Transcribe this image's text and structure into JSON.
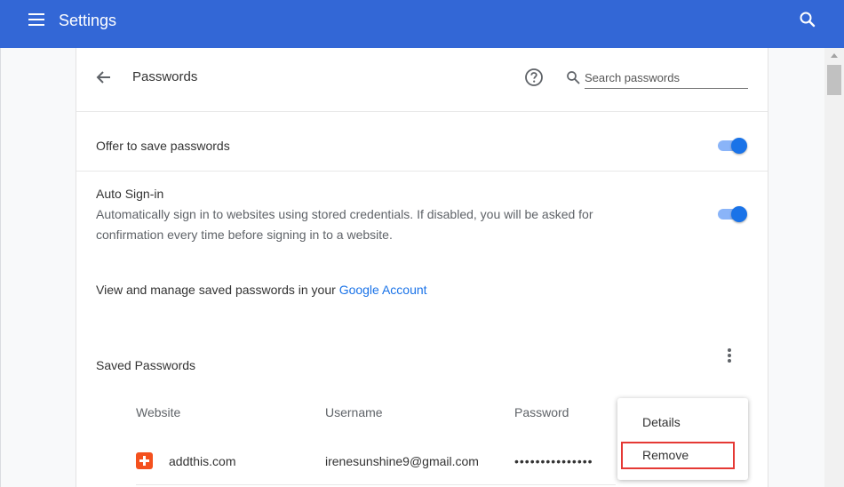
{
  "app": {
    "title": "Settings",
    "menu_icon": "hamburger-menu-icon",
    "search_icon": "search-icon",
    "header_color": "#3367d6"
  },
  "passwords_page": {
    "title": "Passwords",
    "back_icon": "arrow-left-icon",
    "help_icon": "help-circle-icon",
    "search": {
      "placeholder": "Search passwords",
      "value": ""
    }
  },
  "settings": {
    "offer_to_save": {
      "label": "Offer to save passwords",
      "enabled": true
    },
    "auto_signin": {
      "label": "Auto Sign-in",
      "description_line1": "Automatically sign in to websites using stored credentials. If disabled, you will be asked for",
      "description_line2": "confirmation every time before signing in to a website.",
      "enabled": true
    }
  },
  "manage": {
    "text": "View and manage saved passwords in your ",
    "link_text": "Google Account"
  },
  "saved_passwords": {
    "title": "Saved Passwords",
    "more_icon": "more-vert-icon",
    "columns": [
      "Website",
      "Username",
      "Password"
    ],
    "rows": [
      {
        "website": "addthis.com",
        "username": "irenesunshine9@gmail.com",
        "password": "•••••••••••••••"
      }
    ]
  },
  "context_menu": {
    "items": [
      "Details",
      "Remove"
    ],
    "highlighted": "Remove"
  },
  "colors": {
    "accent": "#1a73e8",
    "toggle_track": "#8ab4f8",
    "highlight": "#e53935"
  }
}
